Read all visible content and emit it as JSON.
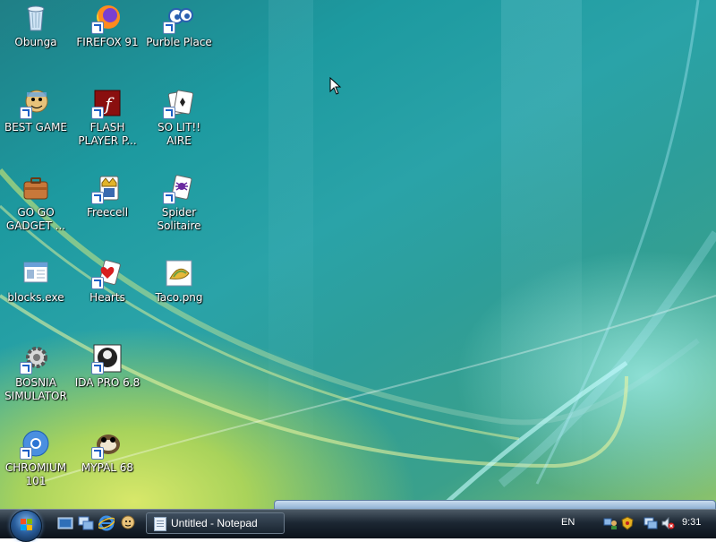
{
  "desktop_icons": [
    {
      "label": "Obunga",
      "icon": "recycle-bin-icon"
    },
    {
      "label": "FIREFOX 91",
      "icon": "firefox-icon"
    },
    {
      "label": "Purble Place",
      "icon": "purble-place-icon"
    },
    {
      "label": "BEST GAME",
      "icon": "game-character-icon"
    },
    {
      "label": "FLASH PLAYER P...",
      "icon": "flash-player-icon"
    },
    {
      "label": "SO LIT!! AIRE",
      "icon": "solitaire-icon"
    },
    {
      "label": "GO GO GADGET ...",
      "icon": "briefcase-icon"
    },
    {
      "label": "Freecell",
      "icon": "freecell-icon"
    },
    {
      "label": "Spider Solitaire",
      "icon": "spider-solitaire-icon"
    },
    {
      "label": "blocks.exe",
      "icon": "application-window-icon"
    },
    {
      "label": "Hearts",
      "icon": "hearts-icon"
    },
    {
      "label": "Taco.png",
      "icon": "image-file-icon"
    },
    {
      "label": "BOSNIA SIMULATOR",
      "icon": "gear-icon"
    },
    {
      "label": "IDA PRO 6.8",
      "icon": "ida-pro-icon"
    },
    {
      "label": "CHROMIUM 101",
      "icon": "chromium-icon"
    },
    {
      "label": "MYPAL 68",
      "icon": "mypal-icon"
    }
  ],
  "taskbar": {
    "quick_launch": [
      "show-desktop-icon",
      "switch-windows-icon",
      "internet-explorer-icon",
      "user-icon"
    ],
    "tasks": [
      {
        "label": "Untitled - Notepad",
        "icon": "notepad-icon"
      }
    ],
    "language": "EN",
    "tray_icons": [
      "network-people-icon",
      "security-icon",
      "network-monitor-icon",
      "volume-muted-icon"
    ],
    "clock": "9:31"
  },
  "colors": {
    "label_text": "#ffffff",
    "taskbar_dark": "#0b121a",
    "wallpaper_teal": "#1d9aa0",
    "wallpaper_green": "#8fc46a"
  }
}
